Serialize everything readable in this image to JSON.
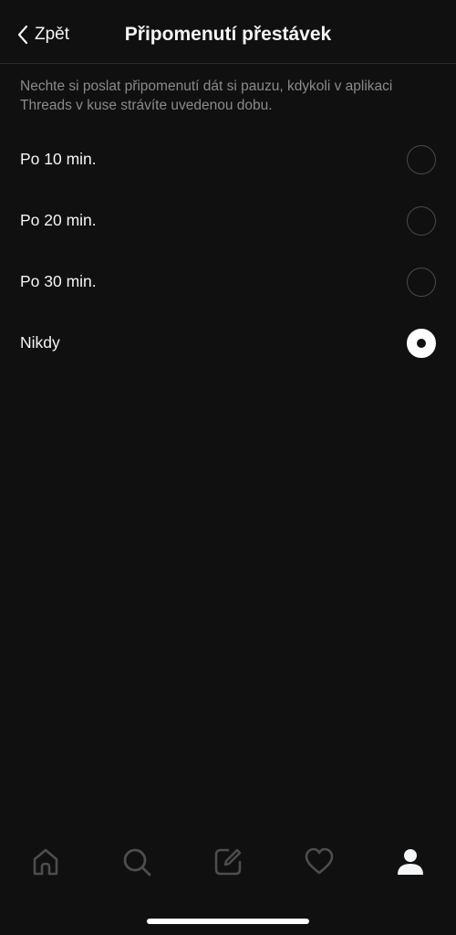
{
  "header": {
    "back_label": "Zpět",
    "title": "Připomenutí přestávek"
  },
  "description": "Nechte si poslat připomenutí dát si pauzu, kdykoli v aplikaci Threads v kuse strávíte uvedenou dobu.",
  "options": [
    {
      "label": "Po 10 min.",
      "selected": false
    },
    {
      "label": "Po 20 min.",
      "selected": false
    },
    {
      "label": "Po 30 min.",
      "selected": false
    },
    {
      "label": "Nikdy",
      "selected": true
    }
  ],
  "tabbar": {
    "items": [
      "home-icon",
      "search-icon",
      "compose-icon",
      "heart-icon",
      "profile-icon"
    ],
    "active": "profile-icon"
  },
  "colors": {
    "background": "#101010",
    "text": "#f3f5f7",
    "muted": "#8a8a8a",
    "inactive_icon": "#4d4d4d"
  }
}
